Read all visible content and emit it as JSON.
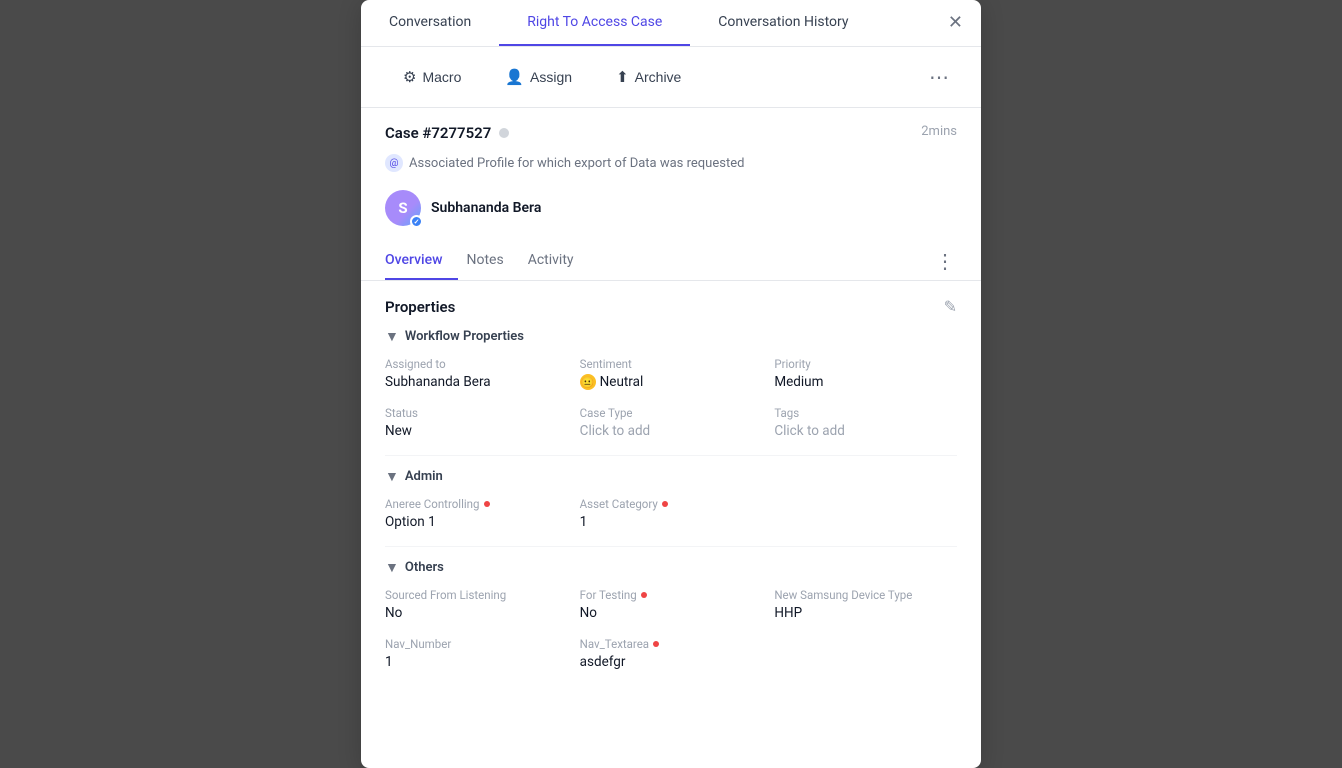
{
  "tabs": [
    {
      "id": "conversation",
      "label": "Conversation",
      "active": false
    },
    {
      "id": "right-access",
      "label": "Right To Access Case",
      "active": true
    },
    {
      "id": "history",
      "label": "Conversation History",
      "active": false
    }
  ],
  "toolbar": {
    "macro_label": "Macro",
    "assign_label": "Assign",
    "archive_label": "Archive"
  },
  "case": {
    "id": "Case #7277527",
    "time": "2mins",
    "subtext": "Associated Profile for which export of Data was requested"
  },
  "profile": {
    "name": "Subhananda Bera",
    "initials": "S"
  },
  "inner_tabs": [
    {
      "id": "overview",
      "label": "Overview",
      "active": true
    },
    {
      "id": "notes",
      "label": "Notes",
      "active": false
    },
    {
      "id": "activity",
      "label": "Activity",
      "active": false
    }
  ],
  "properties_title": "Properties",
  "workflow": {
    "label": "Workflow Properties",
    "fields": {
      "assigned_to_label": "Assigned to",
      "assigned_to_value": "Subhananda Bera",
      "sentiment_label": "Sentiment",
      "sentiment_value": "Neutral",
      "priority_label": "Priority",
      "priority_value": "Medium",
      "status_label": "Status",
      "status_value": "New",
      "case_type_label": "Case Type",
      "case_type_value": "Click to add",
      "tags_label": "Tags",
      "tags_value": "Click to add"
    }
  },
  "admin": {
    "label": "Admin",
    "fields": {
      "aneree_label": "Aneree Controlling",
      "aneree_value": "Option 1",
      "asset_label": "Asset Category",
      "asset_value": "1"
    }
  },
  "others": {
    "label": "Others",
    "fields": {
      "sourced_label": "Sourced From Listening",
      "sourced_value": "No",
      "testing_label": "For Testing",
      "testing_value": "No",
      "samsung_label": "New Samsung Device Type",
      "samsung_value": "HHP",
      "nav_number_label": "Nav_Number",
      "nav_number_value": "1",
      "nav_textarea_label": "Nav_Textarea",
      "nav_textarea_value": "asdefgr"
    }
  }
}
